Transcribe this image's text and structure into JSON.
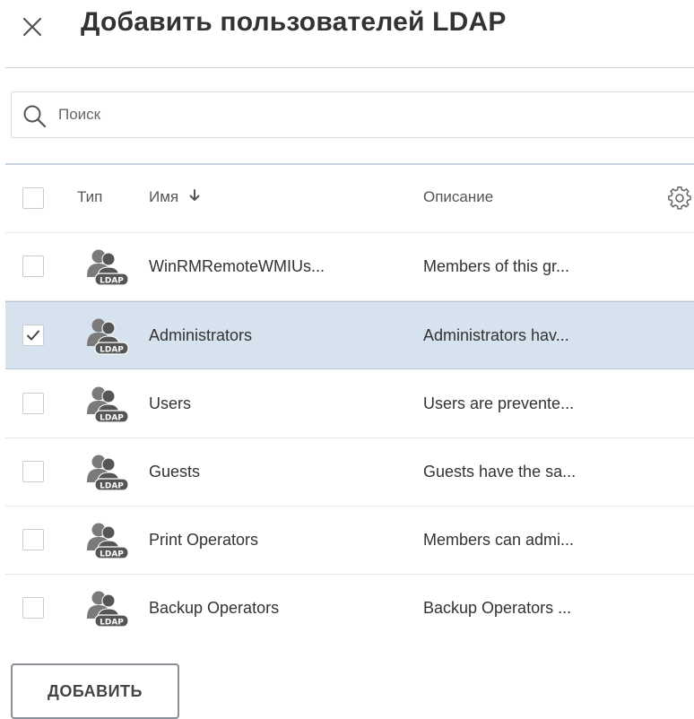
{
  "dialog": {
    "title": "Добавить пользователей LDAP"
  },
  "search": {
    "placeholder": "Поиск"
  },
  "table": {
    "columns": {
      "type": "Тип",
      "name": "Имя",
      "description": "Описание"
    },
    "sort_icon": "arrow-down-icon",
    "settings_icon": "gear-icon",
    "row_icon": "ldap-group-icon",
    "rows": [
      {
        "name": "WinRMRemoteWMIUs...",
        "description": "Members of this gr...",
        "checked": false
      },
      {
        "name": "Administrators",
        "description": "Administrators hav...",
        "checked": true
      },
      {
        "name": "Users",
        "description": "Users are prevente...",
        "checked": false
      },
      {
        "name": "Guests",
        "description": "Guests have the sa...",
        "checked": false
      },
      {
        "name": "Print Operators",
        "description": "Members can admi...",
        "checked": false
      },
      {
        "name": "Backup Operators",
        "description": "Backup Operators ...",
        "checked": false
      }
    ]
  },
  "footer": {
    "add_label": "ДОБАВИТЬ"
  },
  "colors": {
    "selected_row": "#d7e2ef",
    "separator": "#c8d2de",
    "text": "#333333"
  }
}
